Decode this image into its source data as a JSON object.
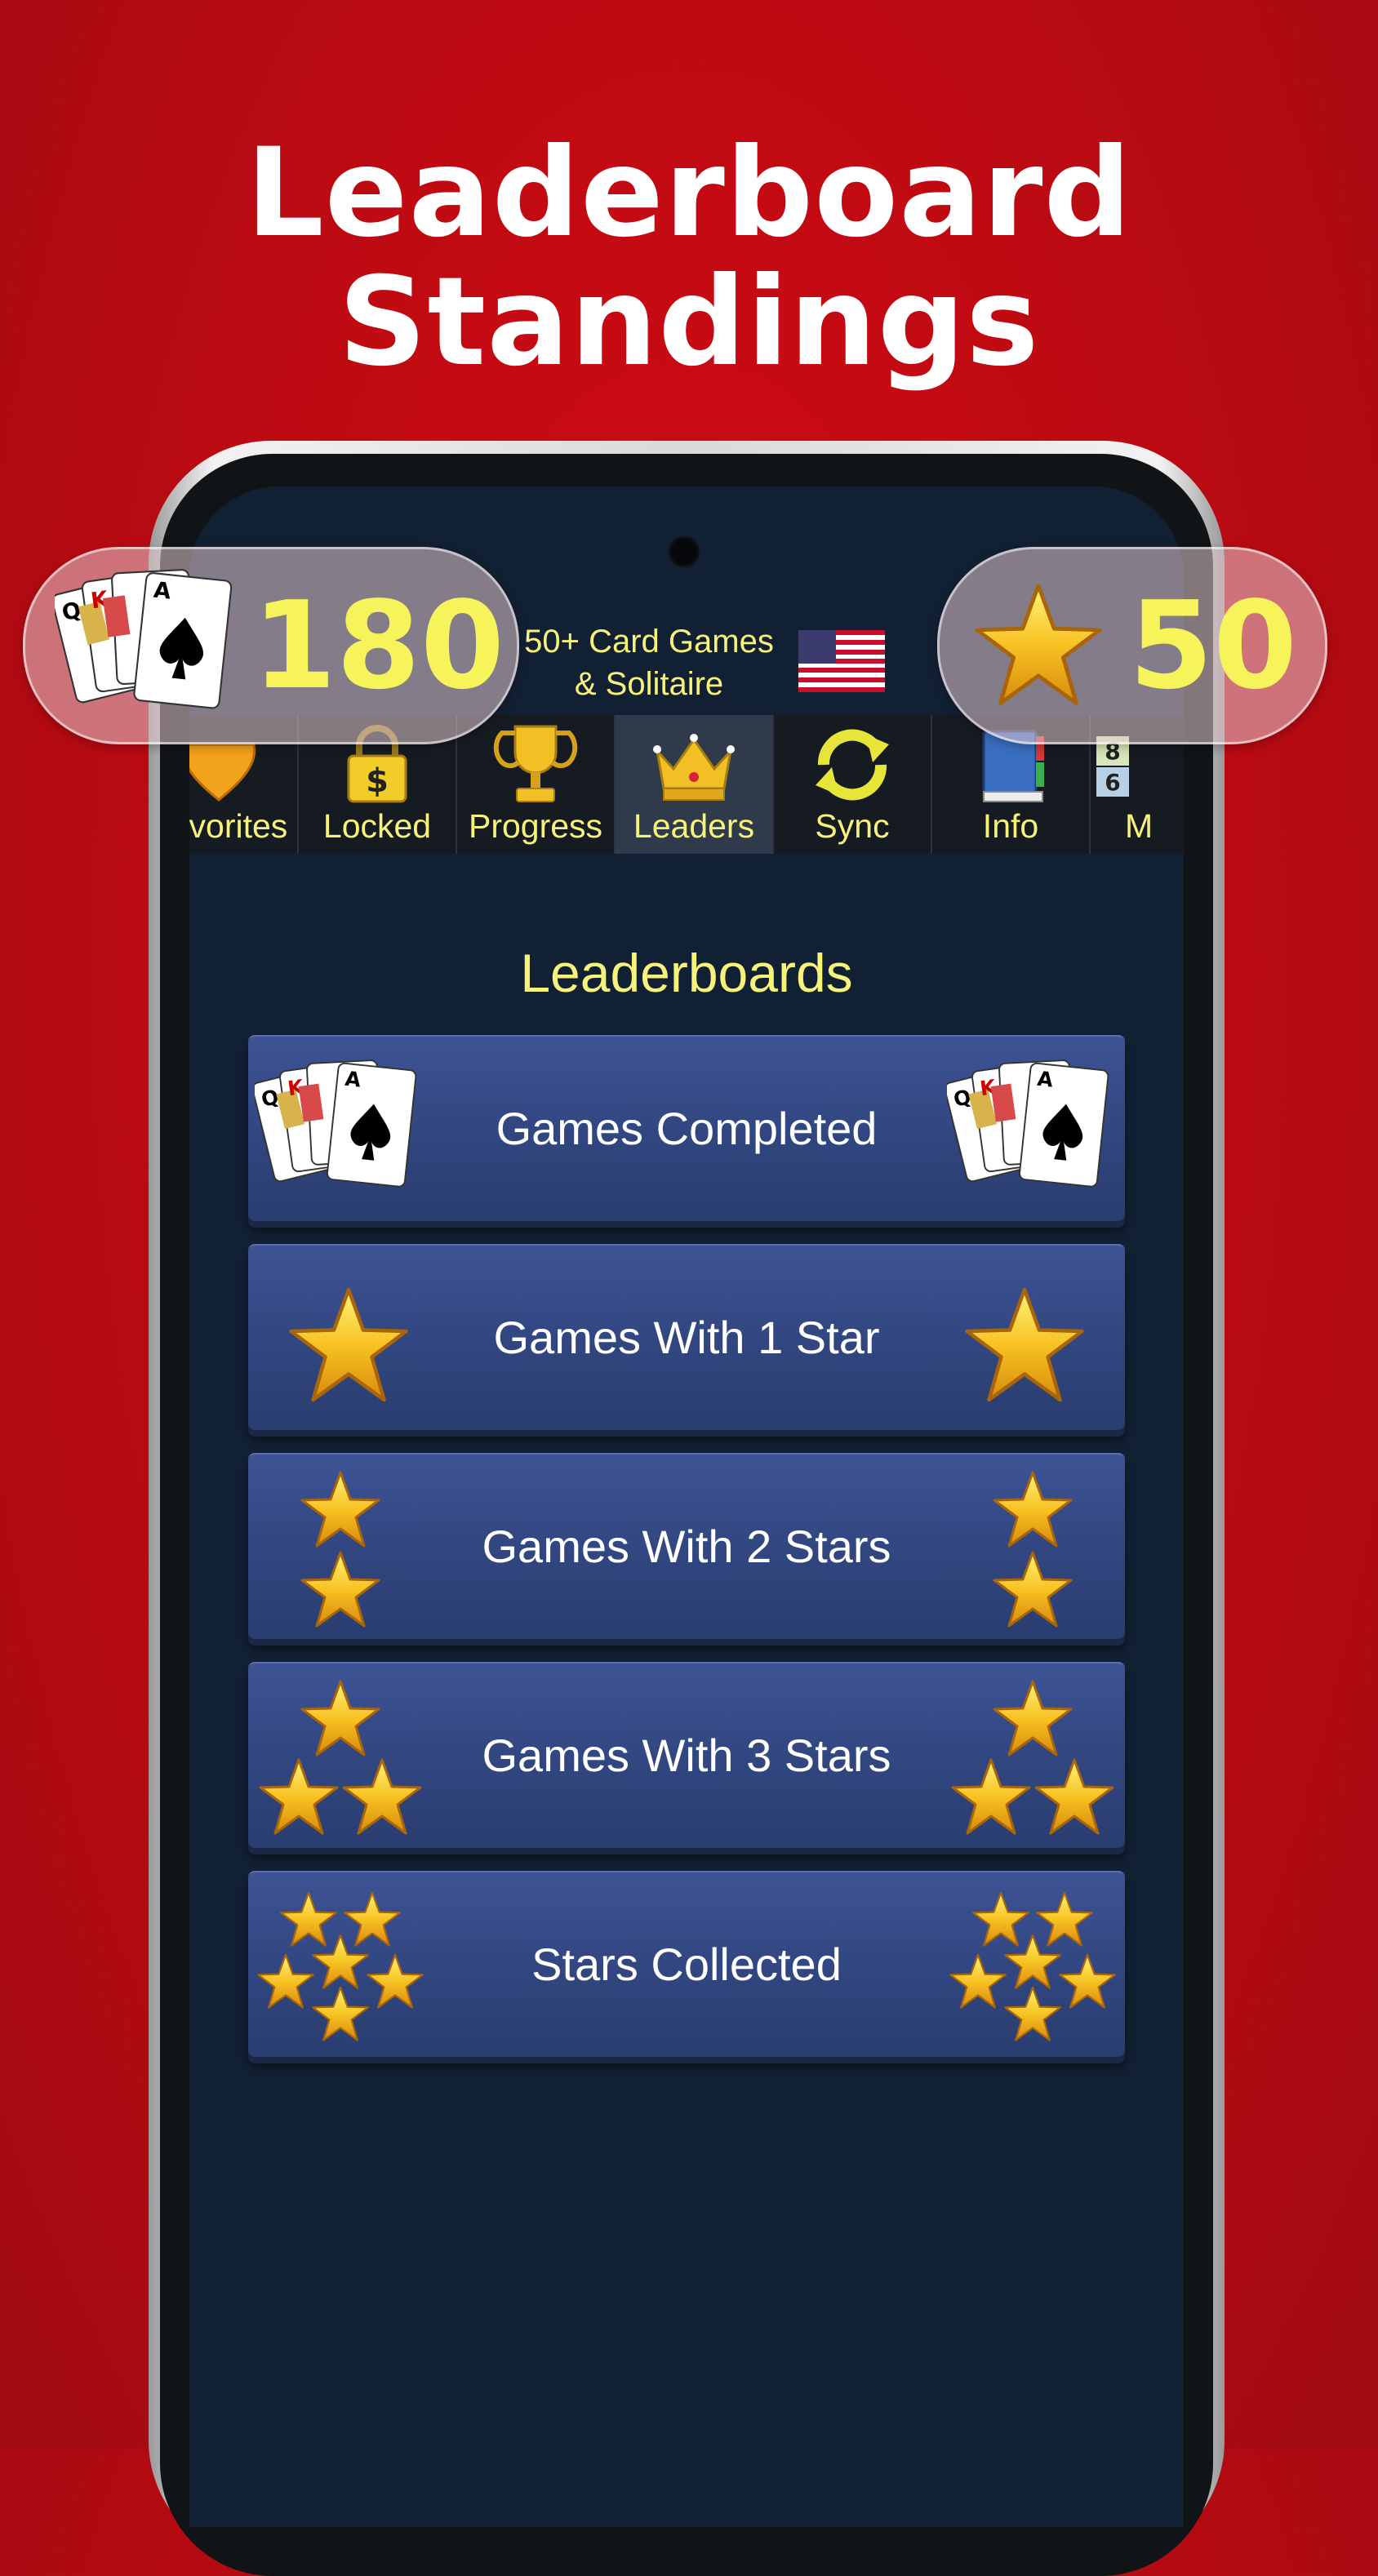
{
  "headline": {
    "line1": "Leaderboard",
    "line2": "Standings"
  },
  "app": {
    "title_line1": "50+ Card Games",
    "title_line2": "& Solitaire",
    "flag_icon": "us-flag-icon"
  },
  "badges": {
    "cards_count": "180",
    "stars_count": "50"
  },
  "tabs": [
    {
      "label": "Favorites",
      "icon": "heart-icon"
    },
    {
      "label": "Locked",
      "icon": "lock-icon"
    },
    {
      "label": "Progress",
      "icon": "trophy-icon"
    },
    {
      "label": "Leaders",
      "icon": "crown-icon",
      "active": true
    },
    {
      "label": "Sync",
      "icon": "sync-icon"
    },
    {
      "label": "Info",
      "icon": "book-icon"
    },
    {
      "label": "M",
      "icon": "numbers-icon"
    }
  ],
  "leaderboards": {
    "title": "Leaderboards",
    "items": [
      {
        "label": "Games Completed",
        "icon": "cards-icon"
      },
      {
        "label": "Games With 1 Star",
        "icon": "one-star-icon"
      },
      {
        "label": "Games With 2 Stars",
        "icon": "two-stars-icon"
      },
      {
        "label": "Games With 3 Stars",
        "icon": "three-stars-icon"
      },
      {
        "label": "Stars Collected",
        "icon": "star-cluster-icon"
      }
    ]
  },
  "colors": {
    "background": "#c00a12",
    "accent_yellow": "#f6f27a",
    "button_blue": "#31467f",
    "screen_bg": "#122033"
  }
}
